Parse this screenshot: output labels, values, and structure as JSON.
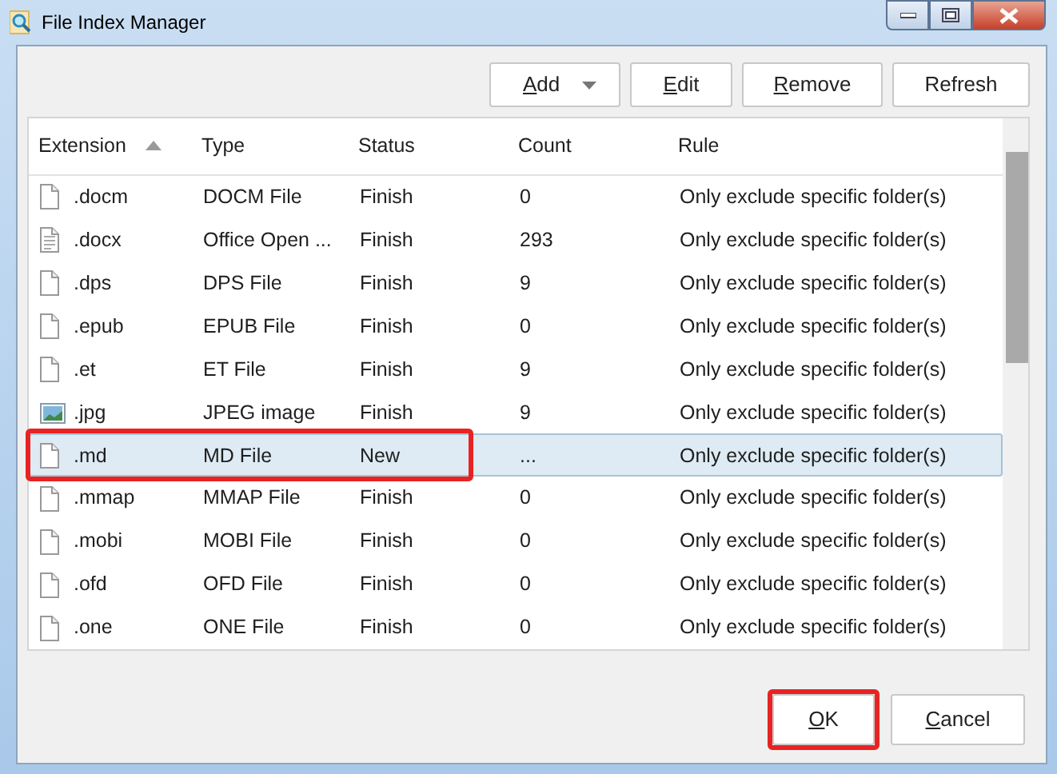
{
  "window": {
    "title": "File Index Manager"
  },
  "toolbar": [
    {
      "label": "Add",
      "mnemonic_first": true,
      "dropdown": true
    },
    {
      "label": "Edit",
      "mnemonic_first": true,
      "dropdown": false
    },
    {
      "label": "Remove",
      "mnemonic_first": true,
      "dropdown": false
    },
    {
      "label": "Refresh",
      "mnemonic_first": false,
      "dropdown": false
    }
  ],
  "table": {
    "columns": [
      {
        "label": "Extension",
        "sorted": true
      },
      {
        "label": "Type",
        "sorted": false
      },
      {
        "label": "Status",
        "sorted": false
      },
      {
        "label": "Count",
        "sorted": false
      },
      {
        "label": "Rule",
        "sorted": false
      }
    ],
    "rows": [
      {
        "kind": "file",
        "extension": ".docm",
        "type": "DOCM File",
        "status": "Finish",
        "count": "0",
        "rule": "Only exclude specific folder(s)",
        "selected": false,
        "highlighted": false
      },
      {
        "kind": "text",
        "extension": ".docx",
        "type": "Office Open ...",
        "status": "Finish",
        "count": "293",
        "rule": "Only exclude specific folder(s)",
        "selected": false,
        "highlighted": false
      },
      {
        "kind": "file",
        "extension": ".dps",
        "type": "DPS File",
        "status": "Finish",
        "count": "9",
        "rule": "Only exclude specific folder(s)",
        "selected": false,
        "highlighted": false
      },
      {
        "kind": "file",
        "extension": ".epub",
        "type": "EPUB File",
        "status": "Finish",
        "count": "0",
        "rule": "Only exclude specific folder(s)",
        "selected": false,
        "highlighted": false
      },
      {
        "kind": "file",
        "extension": ".et",
        "type": "ET File",
        "status": "Finish",
        "count": "9",
        "rule": "Only exclude specific folder(s)",
        "selected": false,
        "highlighted": false
      },
      {
        "kind": "image",
        "extension": ".jpg",
        "type": "JPEG image",
        "status": "Finish",
        "count": "9",
        "rule": "Only exclude specific folder(s)",
        "selected": false,
        "highlighted": false
      },
      {
        "kind": "file",
        "extension": ".md",
        "type": "MD File",
        "status": "New",
        "count": "...",
        "rule": "Only exclude specific folder(s)",
        "selected": true,
        "highlighted": true
      },
      {
        "kind": "file",
        "extension": ".mmap",
        "type": "MMAP File",
        "status": "Finish",
        "count": "0",
        "rule": "Only exclude specific folder(s)",
        "selected": false,
        "highlighted": false
      },
      {
        "kind": "file",
        "extension": ".mobi",
        "type": "MOBI File",
        "status": "Finish",
        "count": "0",
        "rule": "Only exclude specific folder(s)",
        "selected": false,
        "highlighted": false
      },
      {
        "kind": "file",
        "extension": ".ofd",
        "type": "OFD File",
        "status": "Finish",
        "count": "0",
        "rule": "Only exclude specific folder(s)",
        "selected": false,
        "highlighted": false
      },
      {
        "kind": "file",
        "extension": ".one",
        "type": "ONE File",
        "status": "Finish",
        "count": "0",
        "rule": "Only exclude specific folder(s)",
        "selected": false,
        "highlighted": false
      }
    ]
  },
  "buttons": [
    {
      "label": "OK",
      "mnemonic_first": true,
      "highlighted": true
    },
    {
      "label": "Cancel",
      "mnemonic_first": true,
      "highlighted": false
    }
  ]
}
